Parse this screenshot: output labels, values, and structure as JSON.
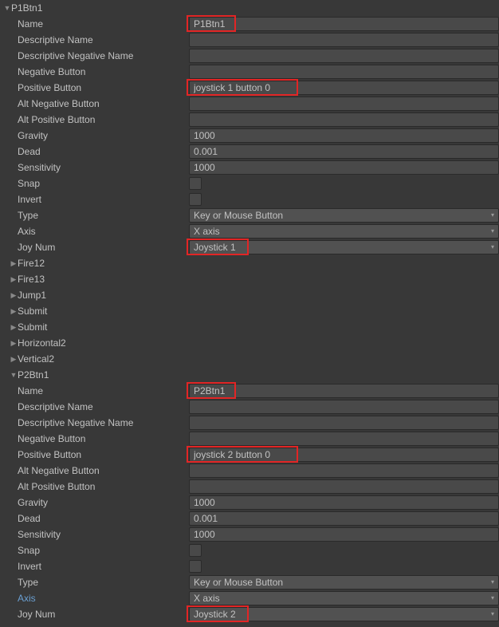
{
  "items": [
    {
      "label": "P1Btn1",
      "type": "header",
      "foldout": "down",
      "indent": 0
    },
    {
      "label": "Name",
      "type": "text",
      "value": "P1Btn1",
      "indent": 2,
      "hl": "hl-name1"
    },
    {
      "label": "Descriptive Name",
      "type": "text",
      "value": "",
      "indent": 2
    },
    {
      "label": "Descriptive Negative Name",
      "type": "text",
      "value": "",
      "indent": 2
    },
    {
      "label": "Negative Button",
      "type": "text",
      "value": "",
      "indent": 2
    },
    {
      "label": "Positive Button",
      "type": "text",
      "value": "joystick 1 button 0",
      "indent": 2,
      "hl": "hl-pos1"
    },
    {
      "label": "Alt Negative Button",
      "type": "text",
      "value": "",
      "indent": 2
    },
    {
      "label": "Alt Positive Button",
      "type": "text",
      "value": "",
      "indent": 2
    },
    {
      "label": "Gravity",
      "type": "text",
      "value": "1000",
      "indent": 2
    },
    {
      "label": "Dead",
      "type": "text",
      "value": "0.001",
      "indent": 2
    },
    {
      "label": "Sensitivity",
      "type": "text",
      "value": "1000",
      "indent": 2
    },
    {
      "label": "Snap",
      "type": "check",
      "checked": false,
      "indent": 2
    },
    {
      "label": "Invert",
      "type": "check",
      "checked": false,
      "indent": 2
    },
    {
      "label": "Type",
      "type": "dropdown",
      "value": "Key or Mouse Button",
      "indent": 2
    },
    {
      "label": "Axis",
      "type": "dropdown",
      "value": "X axis",
      "indent": 2
    },
    {
      "label": "Joy Num",
      "type": "dropdown",
      "value": "Joystick 1",
      "indent": 2,
      "hl": "hl-joy1"
    },
    {
      "label": "Fire12",
      "type": "header",
      "foldout": "right",
      "indent": 1
    },
    {
      "label": "Fire13",
      "type": "header",
      "foldout": "right",
      "indent": 1
    },
    {
      "label": "Jump1",
      "type": "header",
      "foldout": "right",
      "indent": 1
    },
    {
      "label": "Submit",
      "type": "header",
      "foldout": "right",
      "indent": 1
    },
    {
      "label": "Submit",
      "type": "header",
      "foldout": "right",
      "indent": 1
    },
    {
      "label": "Horizontal2",
      "type": "header",
      "foldout": "right",
      "indent": 1
    },
    {
      "label": "Vertical2",
      "type": "header",
      "foldout": "right",
      "indent": 1
    },
    {
      "label": "P2Btn1",
      "type": "header",
      "foldout": "down",
      "indent": 1
    },
    {
      "label": "Name",
      "type": "text",
      "value": "P2Btn1",
      "indent": 2,
      "hl": "hl-name2"
    },
    {
      "label": "Descriptive Name",
      "type": "text",
      "value": "",
      "indent": 2
    },
    {
      "label": "Descriptive Negative Name",
      "type": "text",
      "value": "",
      "indent": 2
    },
    {
      "label": "Negative Button",
      "type": "text",
      "value": "",
      "indent": 2
    },
    {
      "label": "Positive Button",
      "type": "text",
      "value": "joystick 2 button 0",
      "indent": 2,
      "hl": "hl-pos2"
    },
    {
      "label": "Alt Negative Button",
      "type": "text",
      "value": "",
      "indent": 2
    },
    {
      "label": "Alt Positive Button",
      "type": "text",
      "value": "",
      "indent": 2
    },
    {
      "label": "Gravity",
      "type": "text",
      "value": "1000",
      "indent": 2
    },
    {
      "label": "Dead",
      "type": "text",
      "value": "0.001",
      "indent": 2
    },
    {
      "label": "Sensitivity",
      "type": "text",
      "value": "1000",
      "indent": 2
    },
    {
      "label": "Snap",
      "type": "check",
      "checked": false,
      "indent": 2
    },
    {
      "label": "Invert",
      "type": "check",
      "checked": false,
      "indent": 2
    },
    {
      "label": "Type",
      "type": "dropdown",
      "value": "Key or Mouse Button",
      "indent": 2
    },
    {
      "label": "Axis",
      "type": "dropdown",
      "value": "X axis",
      "indent": 2,
      "selected": true
    },
    {
      "label": "Joy Num",
      "type": "dropdown",
      "value": "Joystick 2",
      "indent": 2,
      "hl": "hl-joy2"
    }
  ]
}
